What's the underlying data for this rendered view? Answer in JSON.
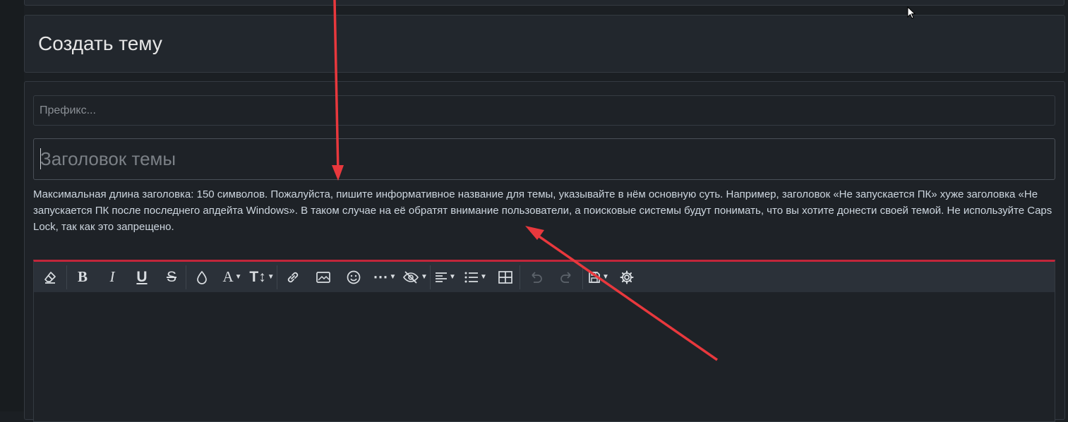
{
  "page": {
    "title": "Создать тему"
  },
  "form": {
    "prefix_placeholder": "Префикс...",
    "title_placeholder": "Заголовок темы",
    "hint": "Максимальная длина заголовка: 150 символов. Пожалуйста, пишите информативное название для темы, указывайте в нём основную суть. Например, заголовок «Не запускается ПК» хуже заголовка «Не запускается ПК после последнего апдейта Windows». В таком случае на её обратят внимание пользователи, а поисковые системы будут понимать, что вы хотите донести своей темой. Не используйте Caps Lock, так как это запрещено."
  },
  "toolbar": {
    "buttons": [
      {
        "name": "remove-format-icon",
        "glyph": "⌫"
      },
      {
        "name": "bold-icon",
        "glyph": "B"
      },
      {
        "name": "italic-icon",
        "glyph": "I"
      },
      {
        "name": "underline-icon",
        "glyph": "U"
      },
      {
        "name": "strikethrough-icon",
        "glyph": "S"
      },
      {
        "name": "text-color-icon",
        "glyph": "💧"
      },
      {
        "name": "font-family-icon",
        "glyph": "A"
      },
      {
        "name": "font-size-icon",
        "glyph": "T↕"
      },
      {
        "name": "link-icon",
        "glyph": "🔗"
      },
      {
        "name": "image-icon",
        "glyph": "🖼"
      },
      {
        "name": "emoji-icon",
        "glyph": "☺"
      },
      {
        "name": "more-icon",
        "glyph": "⋯"
      },
      {
        "name": "hide-icon",
        "glyph": "👁"
      },
      {
        "name": "align-icon",
        "glyph": "≡"
      },
      {
        "name": "list-icon",
        "glyph": "☰"
      },
      {
        "name": "table-icon",
        "glyph": "▦"
      },
      {
        "name": "undo-icon",
        "glyph": "↶"
      },
      {
        "name": "redo-icon",
        "glyph": "↷"
      },
      {
        "name": "drafts-icon",
        "glyph": "💾"
      },
      {
        "name": "settings-icon",
        "glyph": "⚙"
      }
    ]
  },
  "colors": {
    "accent": "#c2263a",
    "annotation_arrow": "#e8383d",
    "background": "#1b1f23",
    "panel": "#22272d",
    "hint_text": "#cdd6df"
  }
}
